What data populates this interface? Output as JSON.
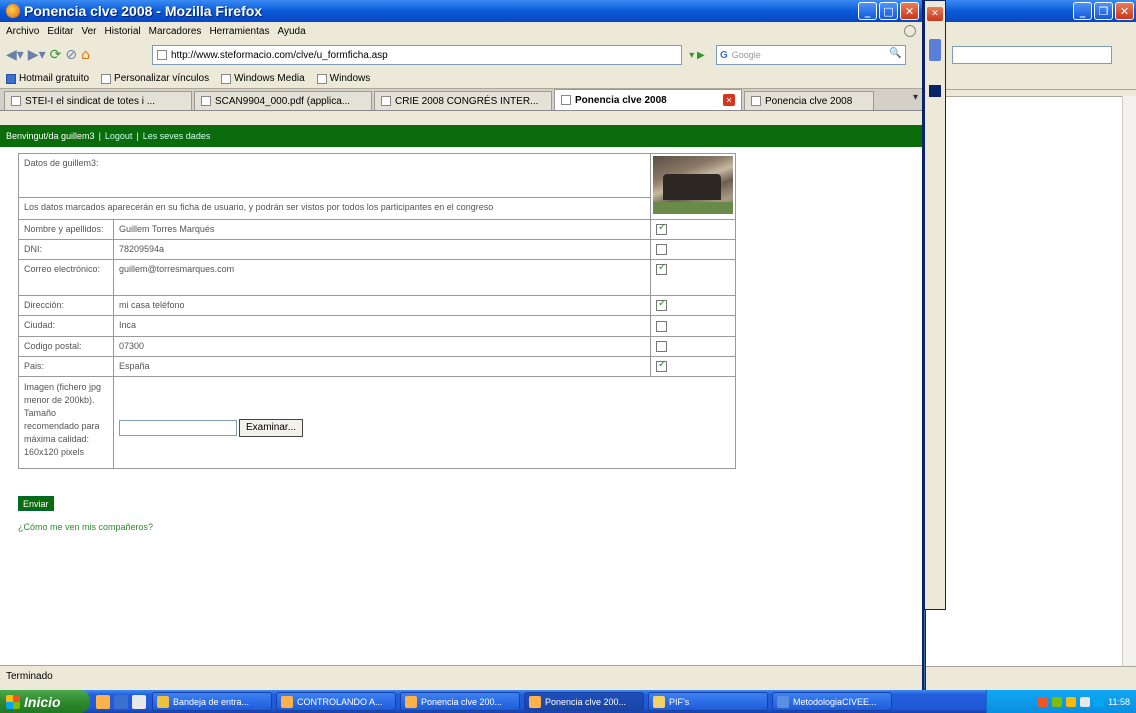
{
  "main_window": {
    "title": "Ponencia clve 2008 - Mozilla Firefox",
    "menu": [
      "Archivo",
      "Editar",
      "Ver",
      "Historial",
      "Marcadores",
      "Herramientas",
      "Ayuda"
    ],
    "url": "http://www.steformacio.com/clve/u_formficha.asp",
    "search_engine": "G",
    "search_placeholder": "Google",
    "bookmarks": [
      "Hotmail gratuito",
      "Personalizar vínculos",
      "Windows Media",
      "Windows"
    ],
    "tabs": [
      {
        "label": "STEI-I el sindicat de totes i ...",
        "active": false
      },
      {
        "label": "SCAN9904_000.pdf (applica...",
        "active": false
      },
      {
        "label": "CRIE 2008 CONGRÉS INTER...",
        "active": false
      },
      {
        "label": "Ponencia clve 2008",
        "active": true
      },
      {
        "label": "Ponencia clve 2008",
        "active": false
      }
    ],
    "status": "Terminado"
  },
  "page": {
    "welcome": "Benvingut/da guillem3",
    "logout": "Logout",
    "my_data": "Les seves dades",
    "data_title": "Datos de guillem3:",
    "notice": "Los datos marcados aparecerán en su ficha de usuario, y podrán ser vistos por todos los participantes en el congreso",
    "fields": [
      {
        "label": "Nombre y apellidos:",
        "value": "Guillem Torres Marqués",
        "checked": true
      },
      {
        "label": "DNI:",
        "value": "78209594a",
        "checked": false
      },
      {
        "label": "Correo electrónico:",
        "value": "guillem@torresmarques.com",
        "checked": true
      },
      {
        "label": "Dirección:",
        "value": "mi casa teléfono",
        "checked": true
      },
      {
        "label": "Ciudad:",
        "value": "Inca",
        "checked": false
      },
      {
        "label": "Codigo postal:",
        "value": "07300",
        "checked": false
      },
      {
        "label": "Pais:",
        "value": "España",
        "checked": true
      }
    ],
    "image_label": "Imagen (fichero jpg menor de 200kb). Tamaño recomendado para máxima calidad: 160x120 pixels",
    "browse_button": "Examinar...",
    "submit": "Enviar",
    "peers_link": "¿Cómo me ven mis compañeros?"
  },
  "taskbar": {
    "start": "Inicio",
    "tasks": [
      {
        "label": "Bandeja de entra...",
        "active": false
      },
      {
        "label": "CONTROLANDO A...",
        "active": false
      },
      {
        "label": "Ponencia clve 200...",
        "active": false
      },
      {
        "label": "Ponencia clve 200...",
        "active": true
      },
      {
        "label": "PIF's",
        "active": false
      },
      {
        "label": "MetodologiaCIVEE...",
        "active": false
      }
    ],
    "clock": "11:58"
  },
  "colors": {
    "green_bar": "#0b6c0b",
    "xp_blue": "#0a5ad8"
  }
}
